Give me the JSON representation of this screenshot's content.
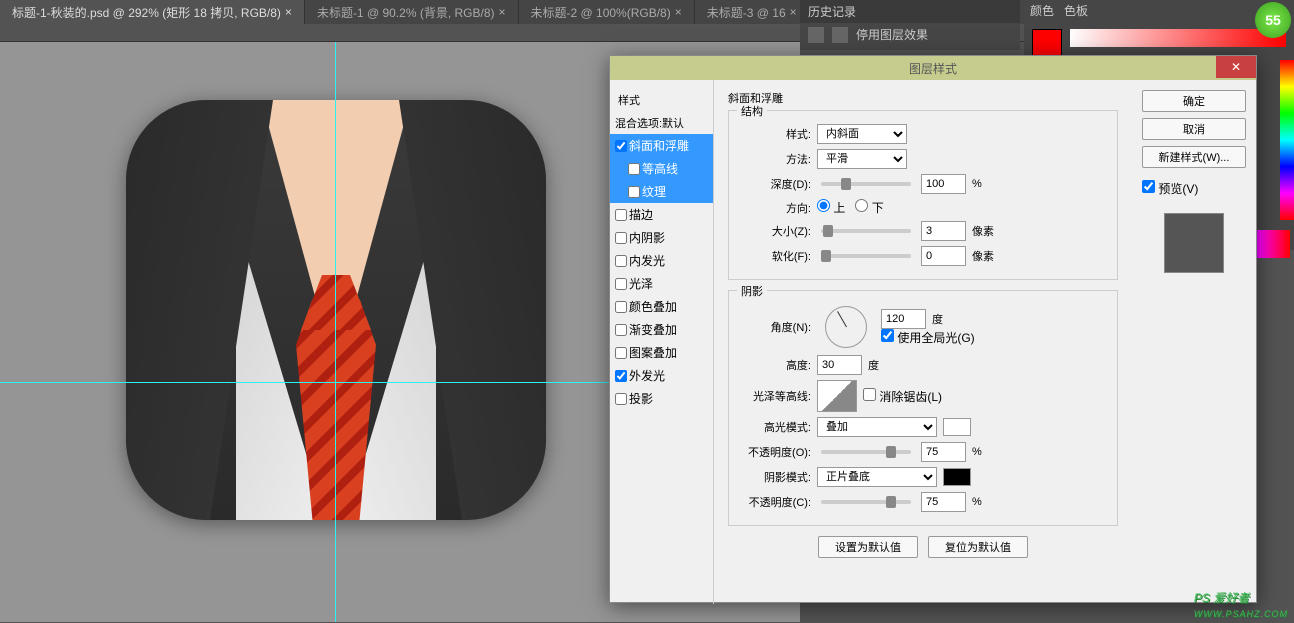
{
  "tabs": [
    {
      "label": "标题-1-秋装的.psd @ 292% (矩形 18 拷贝, RGB/8)",
      "active": true
    },
    {
      "label": "未标题-1 @ 90.2% (背景, RGB/8)",
      "active": false
    },
    {
      "label": "未标题-2 @ 100%(RGB/8)",
      "active": false
    },
    {
      "label": "未标题-3 @ 16",
      "active": false
    }
  ],
  "history": {
    "title": "历史记录",
    "item": "停用图层效果"
  },
  "color_panel": {
    "tab1": "颜色",
    "tab2": "色板"
  },
  "badge": "55",
  "dialog": {
    "title": "图层样式",
    "styles_header": "样式",
    "blend_default": "混合选项:默认",
    "styles": [
      {
        "label": "斜面和浮雕",
        "checked": true,
        "selected": true
      },
      {
        "label": "等高线",
        "checked": false,
        "selected": true,
        "indent": true
      },
      {
        "label": "纹理",
        "checked": false,
        "selected": true,
        "indent": true
      },
      {
        "label": "描边",
        "checked": false
      },
      {
        "label": "内阴影",
        "checked": false
      },
      {
        "label": "内发光",
        "checked": false
      },
      {
        "label": "光泽",
        "checked": false
      },
      {
        "label": "颜色叠加",
        "checked": false
      },
      {
        "label": "渐变叠加",
        "checked": false
      },
      {
        "label": "图案叠加",
        "checked": false
      },
      {
        "label": "外发光",
        "checked": true
      },
      {
        "label": "投影",
        "checked": false
      }
    ],
    "section_title": "斜面和浮雕",
    "structure": {
      "title": "结构",
      "style_label": "样式:",
      "style_value": "内斜面",
      "method_label": "方法:",
      "method_value": "平滑",
      "depth_label": "深度(D):",
      "depth_value": "100",
      "depth_unit": "%",
      "direction_label": "方向:",
      "up": "上",
      "down": "下",
      "size_label": "大小(Z):",
      "size_value": "3",
      "size_unit": "像素",
      "soften_label": "软化(F):",
      "soften_value": "0",
      "soften_unit": "像素"
    },
    "shading": {
      "title": "阴影",
      "angle_label": "角度(N):",
      "angle_value": "120",
      "angle_unit": "度",
      "global_label": "使用全局光(G)",
      "altitude_label": "高度:",
      "altitude_value": "30",
      "altitude_unit": "度",
      "gloss_label": "光泽等高线:",
      "antialias_label": "消除锯齿(L)",
      "highlight_mode_label": "高光模式:",
      "highlight_mode_value": "叠加",
      "highlight_opacity_label": "不透明度(O):",
      "highlight_opacity_value": "75",
      "opacity_unit": "%",
      "shadow_mode_label": "阴影模式:",
      "shadow_mode_value": "正片叠底",
      "shadow_opacity_label": "不透明度(C):",
      "shadow_opacity_value": "75"
    },
    "set_default": "设置为默认值",
    "reset_default": "复位为默认值",
    "ok": "确定",
    "cancel": "取消",
    "new_style": "新建样式(W)...",
    "preview_label": "预览(V)"
  },
  "watermark": {
    "text": "PS 爱好者",
    "url": "WWW.PSAHZ.COM"
  }
}
